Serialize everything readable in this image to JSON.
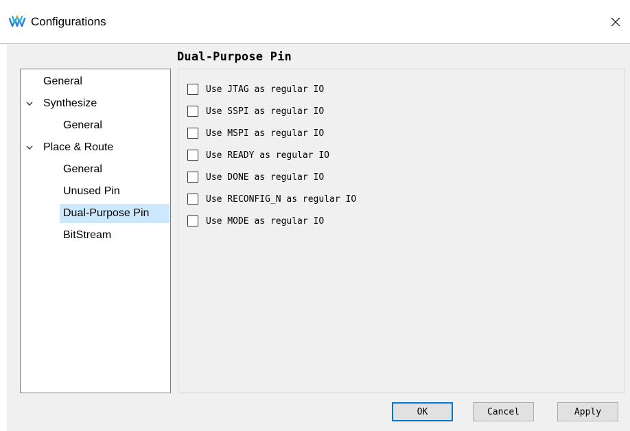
{
  "window": {
    "title": "Configurations",
    "app_icon": "gowin-logo-icon",
    "close_icon": "close-icon"
  },
  "page": {
    "title": "Dual-Purpose Pin"
  },
  "tree": {
    "items": [
      {
        "label": "General",
        "level": 0,
        "expandable": false,
        "selected": false
      },
      {
        "label": "Synthesize",
        "level": 0,
        "expandable": true,
        "expanded": true,
        "selected": false
      },
      {
        "label": "General",
        "level": 1,
        "expandable": false,
        "selected": false
      },
      {
        "label": "Place & Route",
        "level": 0,
        "expandable": true,
        "expanded": true,
        "selected": false
      },
      {
        "label": "General",
        "level": 1,
        "expandable": false,
        "selected": false
      },
      {
        "label": "Unused Pin",
        "level": 1,
        "expandable": false,
        "selected": false
      },
      {
        "label": "Dual-Purpose Pin",
        "level": 1,
        "expandable": false,
        "selected": true
      },
      {
        "label": "BitStream",
        "level": 1,
        "expandable": false,
        "selected": false
      }
    ]
  },
  "options": [
    {
      "label": "Use JTAG as regular IO",
      "checked": false
    },
    {
      "label": "Use SSPI as regular IO",
      "checked": false
    },
    {
      "label": "Use MSPI as regular IO",
      "checked": false
    },
    {
      "label": "Use READY as regular IO",
      "checked": false
    },
    {
      "label": "Use DONE as regular IO",
      "checked": false
    },
    {
      "label": "Use RECONFIG_N as regular IO",
      "checked": false
    },
    {
      "label": "Use MODE as regular IO",
      "checked": false
    }
  ],
  "buttons": {
    "ok": "OK",
    "cancel": "Cancel",
    "apply": "Apply"
  },
  "colors": {
    "selection": "#cce8ff",
    "focus_border": "#0078d7",
    "dialog_bg": "#f0f0f0"
  }
}
